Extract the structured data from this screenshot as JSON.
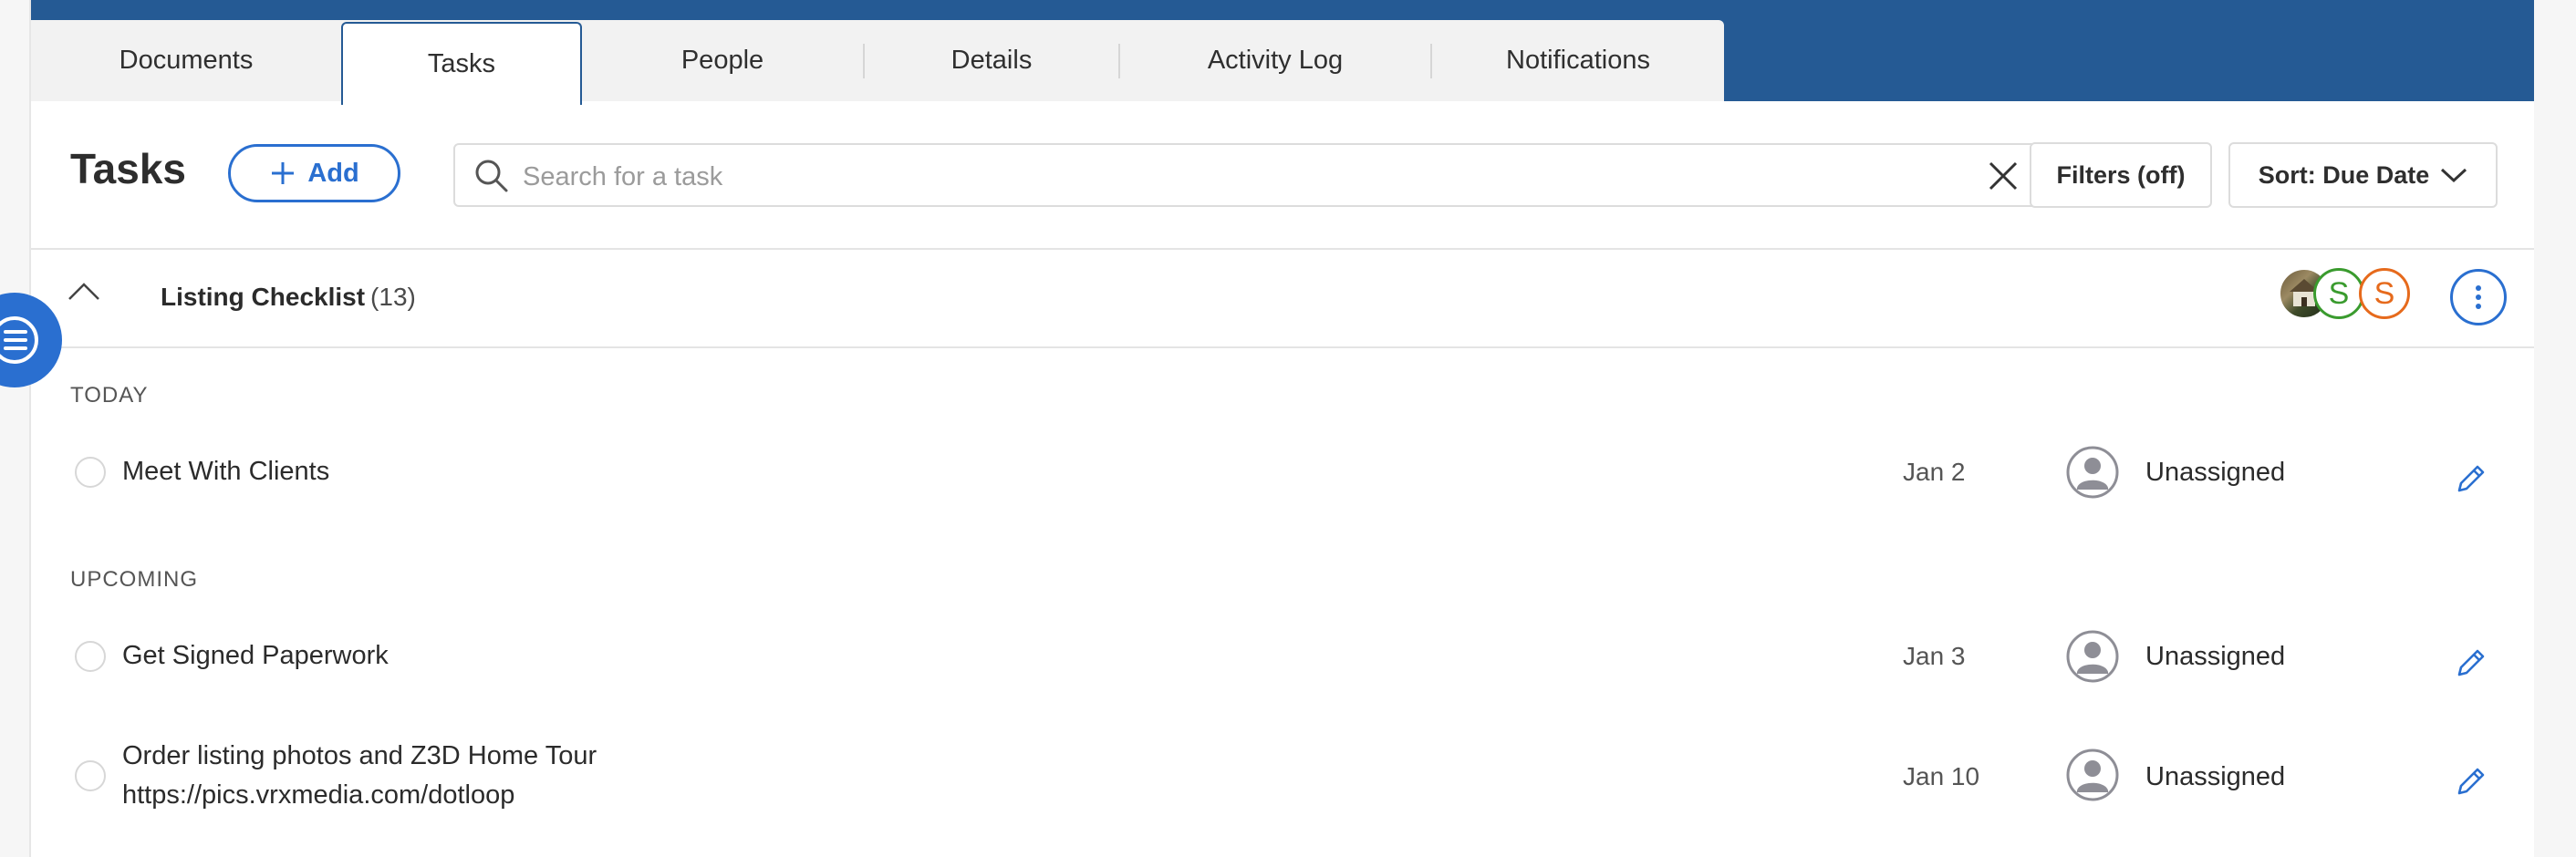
{
  "tabs": [
    {
      "label": "Documents",
      "active": false
    },
    {
      "label": "Tasks",
      "active": true
    },
    {
      "label": "People",
      "active": false
    },
    {
      "label": "Details",
      "active": false
    },
    {
      "label": "Activity Log",
      "active": false
    },
    {
      "label": "Notifications",
      "active": false
    }
  ],
  "toolbar": {
    "title": "Tasks",
    "add_label": "Add",
    "search_placeholder": "Search for a task",
    "search_value": "",
    "filters_label": "Filters (off)",
    "sort_label": "Sort: Due Date"
  },
  "group": {
    "title": "Listing Checklist",
    "count": "(13)",
    "avatars": [
      {
        "type": "photo",
        "icon": "house-photo-avatar"
      },
      {
        "type": "letter",
        "letter": "S",
        "color": "#3a9b2e"
      },
      {
        "type": "letter",
        "letter": "S",
        "color": "#e66a1c"
      }
    ],
    "expanded": true
  },
  "sections": [
    {
      "label": "TODAY",
      "tasks": [
        {
          "name": "Meet With Clients",
          "date": "Jan 2",
          "assignee": "Unassigned"
        }
      ]
    },
    {
      "label": "UPCOMING",
      "tasks": [
        {
          "name": "Get Signed Paperwork",
          "date": "Jan 3",
          "assignee": "Unassigned"
        },
        {
          "name": "Order listing photos and Z3D Home Tour",
          "subtext": "https://pics.vrxmedia.com/dotloop",
          "date": "Jan 10",
          "assignee": "Unassigned"
        }
      ]
    }
  ],
  "colors": {
    "brand": "#255a94",
    "accent": "#2a6fd0"
  }
}
